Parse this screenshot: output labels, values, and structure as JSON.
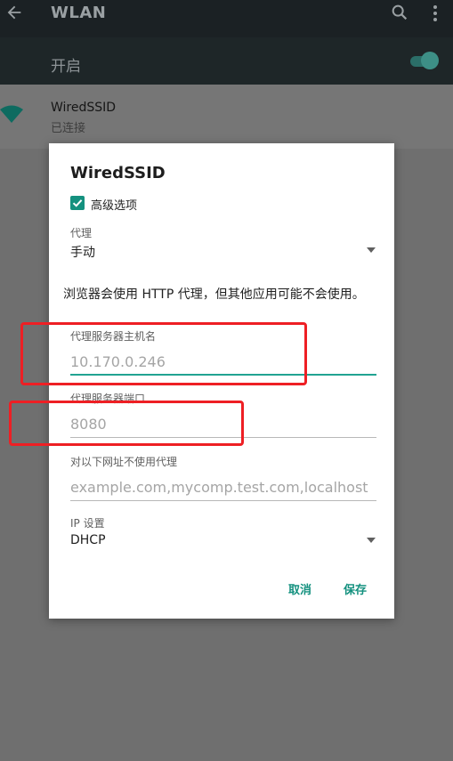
{
  "header": {
    "title": "WLAN"
  },
  "switch_row": {
    "label": "开启",
    "enabled": true
  },
  "network": {
    "name": "WiredSSID",
    "status": "已连接"
  },
  "dialog": {
    "title": "WiredSSID",
    "advanced_label": "高级选项",
    "advanced_checked": true,
    "proxy": {
      "label": "代理",
      "value": "手动"
    },
    "notice": "浏览器会使用 HTTP 代理，但其他应用可能不会使用。",
    "hostname": {
      "label": "代理服务器主机名",
      "placeholder": "10.170.0.246"
    },
    "port": {
      "label": "代理服务器端口",
      "placeholder": "8080"
    },
    "bypass": {
      "label": "对以下网址不使用代理",
      "placeholder": "example.com,mycomp.test.com,localhost"
    },
    "ip": {
      "label": "IP 设置",
      "value": "DHCP"
    },
    "cancel_label": "取消",
    "save_label": "保存"
  },
  "colors": {
    "accent": "#14917f",
    "highlight": "#ee1f24",
    "toolbar": "#1b2124"
  },
  "icons": [
    "back-arrow-icon",
    "search-icon",
    "more-vert-icon",
    "wifi-icon",
    "checkbox-checked-icon",
    "dropdown-arrow-icon"
  ]
}
